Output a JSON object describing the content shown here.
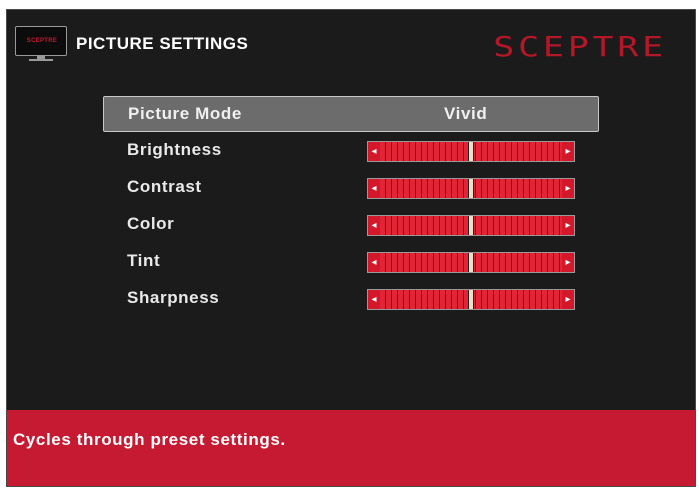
{
  "header": {
    "title": "PICTURE SETTINGS",
    "brand": "SCEPTRE",
    "tv_icon_brand": "SCEPTRE"
  },
  "menu": {
    "picture_mode": {
      "label": "Picture Mode",
      "value": "Vivid"
    },
    "sliders": [
      {
        "label": "Brightness",
        "level": 0.5
      },
      {
        "label": "Contrast",
        "level": 0.5
      },
      {
        "label": "Color",
        "level": 0.5
      },
      {
        "label": "Tint",
        "level": 0.5
      },
      {
        "label": "Sharpness",
        "level": 0.5
      }
    ]
  },
  "footer": {
    "help_text": "Cycles through preset settings."
  },
  "colors": {
    "background": "#1b1b1b",
    "accent_red": "#c51a32",
    "selection": "#6c6c6c"
  }
}
